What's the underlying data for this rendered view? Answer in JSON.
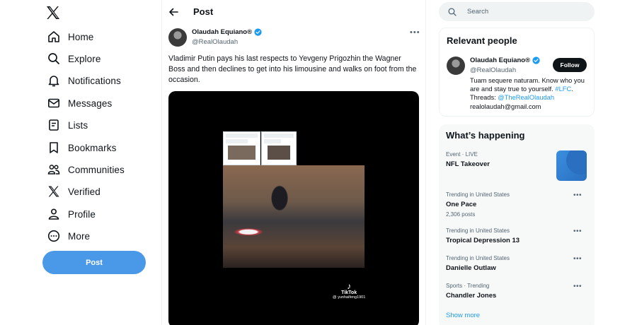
{
  "nav": {
    "logo": "x-logo-icon",
    "items": [
      {
        "label": "Home",
        "icon": "home-icon"
      },
      {
        "label": "Explore",
        "icon": "search-icon"
      },
      {
        "label": "Notifications",
        "icon": "bell-icon"
      },
      {
        "label": "Messages",
        "icon": "envelope-icon"
      },
      {
        "label": "Lists",
        "icon": "list-icon"
      },
      {
        "label": "Bookmarks",
        "icon": "bookmark-icon"
      },
      {
        "label": "Communities",
        "icon": "people-icon"
      },
      {
        "label": "Verified",
        "icon": "x-logo-icon"
      },
      {
        "label": "Profile",
        "icon": "person-icon"
      },
      {
        "label": "More",
        "icon": "more-circle-icon"
      }
    ],
    "post_button": "Post"
  },
  "main": {
    "header_title": "Post",
    "tweet": {
      "author_name": "Olaudah Equiano®",
      "author_handle": "@RealOlaudah",
      "text": "Vladimir Putin pays his last respects to Yevgeny Prigozhin the Wagner Boss and then declines to get into his limousine and walks on foot from the occasion.",
      "watermark_brand": "TikTok",
      "watermark_user": "@ yunhaifeng1901"
    }
  },
  "right": {
    "search_placeholder": "Search",
    "relevant": {
      "title": "Relevant people",
      "name": "Olaudah Equiano®",
      "handle": "@RealOlaudah",
      "follow_label": "Follow",
      "bio_line1": "Tuam sequere naturam. Know who you are and stay true to yourself.",
      "bio_tag": "#LFC",
      "bio_mid": ". Threads: ",
      "bio_mention": "@TheRealOlaudah",
      "bio_email": "realolaudah@gmail.com"
    },
    "happening": {
      "title": "What’s happening",
      "trends": [
        {
          "meta": "Event · LIVE",
          "name": "NFL Takeover",
          "count": ""
        },
        {
          "meta": "Trending in United States",
          "name": "One Pace",
          "count": "2,306 posts"
        },
        {
          "meta": "Trending in United States",
          "name": "Tropical Depression 13",
          "count": ""
        },
        {
          "meta": "Trending in United States",
          "name": "Danielle Outlaw",
          "count": ""
        },
        {
          "meta": "Sports · Trending",
          "name": "Chandler Jones",
          "count": ""
        }
      ],
      "show_more": "Show more"
    }
  },
  "colors": {
    "accent": "#1d9bf0",
    "post_button": "#4a99e9",
    "text": "#0f1419",
    "muted": "#536471"
  }
}
